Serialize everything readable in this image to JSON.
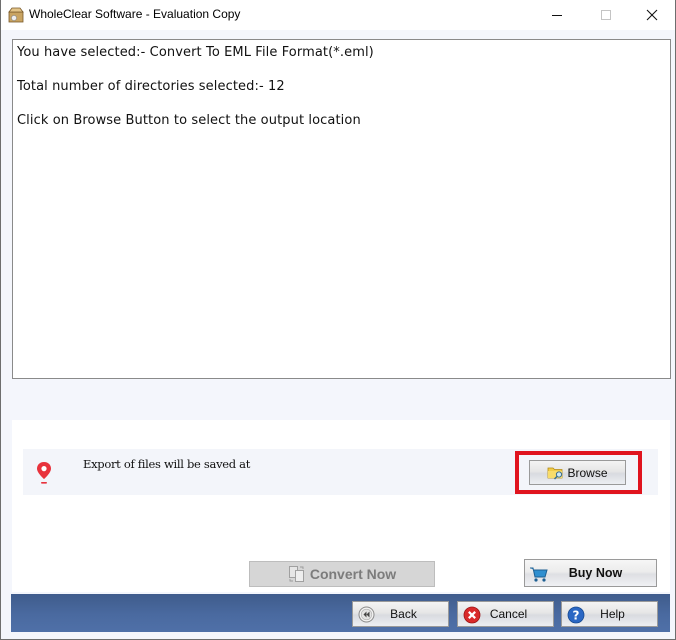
{
  "window": {
    "title": "WholeClear Software - Evaluation Copy",
    "icon": "app-box-icon",
    "controls": [
      "minimize-icon",
      "maximize-icon",
      "close-icon"
    ]
  },
  "output": {
    "lines": [
      "You have selected:- Convert To EML File Format(*.eml)",
      "Total number of directories selected:- 12",
      "Click on Browse Button to select the output location"
    ]
  },
  "export": {
    "icon": "location-pin-icon",
    "label": "Export of files will be saved at",
    "browse_label": "Browse",
    "browse_icon": "folder-search-icon",
    "highlight_color": "#e0141e"
  },
  "actions": {
    "convert_label": "Convert Now",
    "convert_enabled": false,
    "buy_label": "Buy Now",
    "buy_icon": "cart-icon"
  },
  "footer": {
    "back_label": "Back",
    "cancel_label": "Cancel",
    "help_label": "Help",
    "bar_color": "#4a6aa0"
  }
}
